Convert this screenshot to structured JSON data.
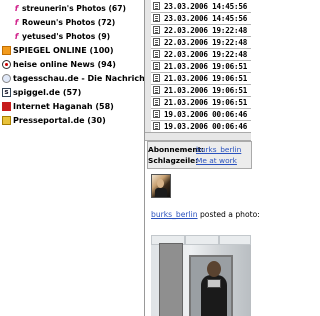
{
  "feeds": [
    {
      "label": "streunerin's Photos (67)",
      "icon": "flickr-icon",
      "sub": true
    },
    {
      "label": "Roweun's Photos (72)",
      "icon": "flickr-icon",
      "sub": true
    },
    {
      "label": "yetused's Photos (9)",
      "icon": "flickr-icon",
      "sub": true
    },
    {
      "label": "SPIEGEL ONLINE (100)",
      "icon": "feed-icon",
      "sub": false
    },
    {
      "label": "heise online News (94)",
      "icon": "heise-icon",
      "sub": false
    },
    {
      "label": "tagesschau.de - Die Nachrichten",
      "icon": "tagesschau-icon",
      "sub": false
    },
    {
      "label": "spiggel.de (57)",
      "icon": "spiggel-icon",
      "sub": false
    },
    {
      "label": "Internet Haganah (58)",
      "icon": "haganah-icon",
      "sub": false
    },
    {
      "label": "Presseportal.de (30)",
      "icon": "presseportal-icon",
      "sub": false
    }
  ],
  "dates": [
    "23.03.2006 14:45:56",
    "23.03.2006 14:45:56",
    "22.03.2006 19:22:48",
    "22.03.2006 19:22:48",
    "22.03.2006 19:22:48",
    "21.03.2006 19:06:51",
    "21.03.2006 19:06:51",
    "21.03.2006 19:06:51",
    "21.03.2006 19:06:51",
    "19.03.2006 00:06:46",
    "19.03.2006 00:06:46"
  ],
  "meta": {
    "subscription_key": "Abonnement:",
    "subscription_value": "burks_berlin",
    "tags_key": "Schlagzeile:",
    "tags_value": "Me at work"
  },
  "post": {
    "user": "burks_berlin",
    "text": " posted a photo:"
  }
}
